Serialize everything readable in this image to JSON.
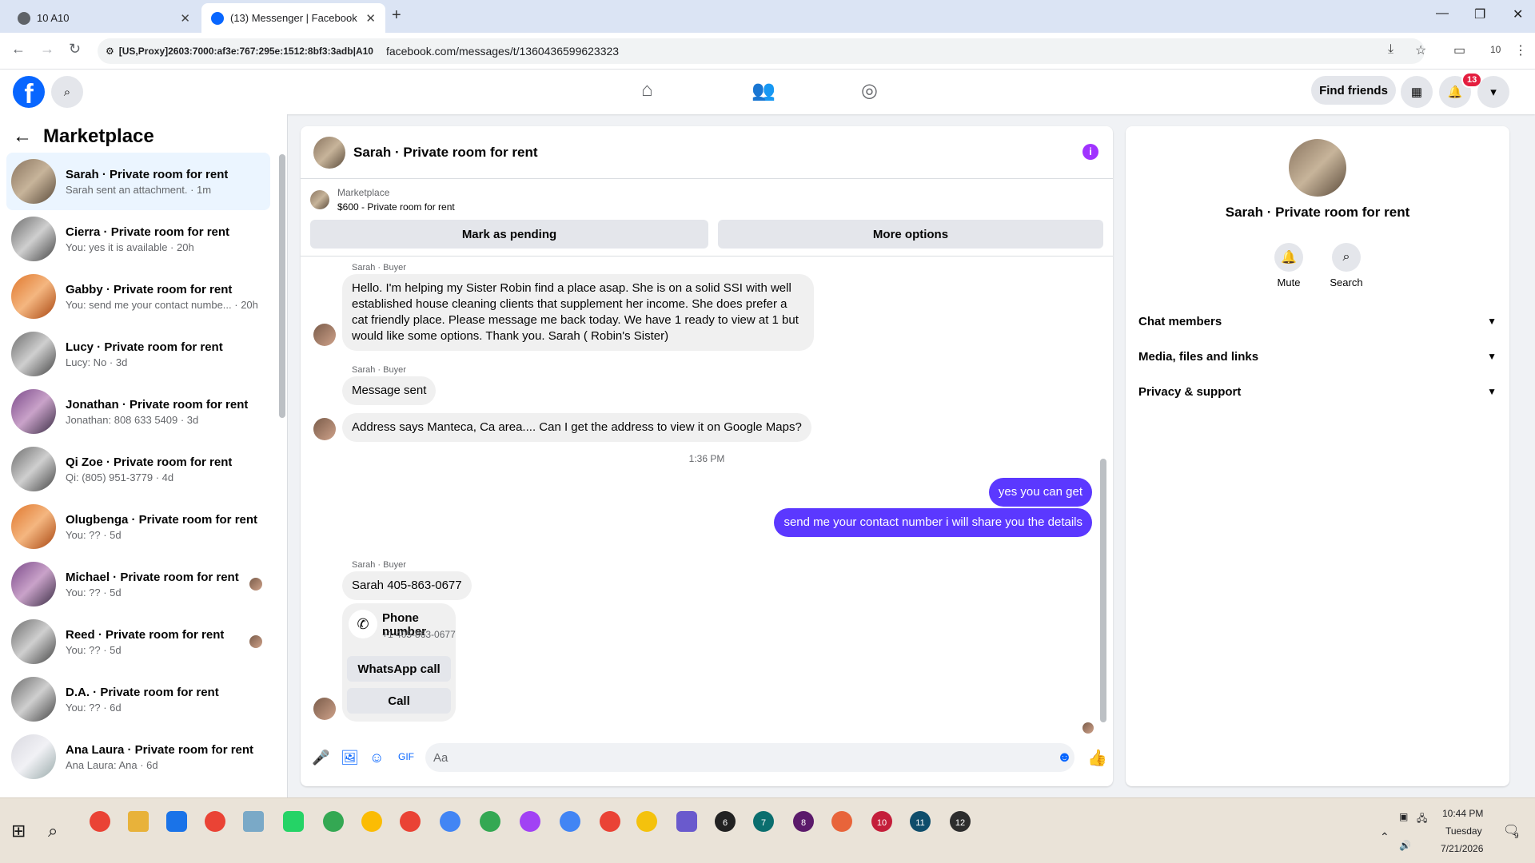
{
  "browser": {
    "tabs": [
      {
        "label": "10 A10"
      },
      {
        "label": "(13) Messenger | Facebook"
      }
    ],
    "proxy": "[US,Proxy]2603:7000:af3e:767:295e:1512:8bf3:3adb|A10",
    "url": "facebook.com/messages/t/1360436599623323",
    "profile_badge": "10"
  },
  "fb": {
    "logo_letter": "f",
    "find_friends": "Find friends",
    "notif_count": "13"
  },
  "sidebar": {
    "title": "Marketplace",
    "conversations": [
      {
        "name": "Sarah · Private room for rent",
        "preview": "Sarah sent an attachment. · 1m"
      },
      {
        "name": "Cierra · Private room for rent",
        "preview": "You: yes it is available · 20h"
      },
      {
        "name": "Gabby · Private room for rent",
        "preview": "You: send me your contact numbe... · 20h"
      },
      {
        "name": "Lucy · Private room for rent",
        "preview": "Lucy: No · 3d"
      },
      {
        "name": "Jonathan · Private room for rent",
        "preview": "Jonathan: 808 633 5409 · 3d"
      },
      {
        "name": "Qi Zoe · Private room for rent",
        "preview": "Qi:  (805)  951-3779 · 4d"
      },
      {
        "name": "Olugbenga · Private room for rent",
        "preview": "You: ?? · 5d"
      },
      {
        "name": "Michael · Private room for rent",
        "preview": "You: ?? · 5d"
      },
      {
        "name": "Reed · Private room for rent",
        "preview": "You: ?? · 5d"
      },
      {
        "name": "D.A. · Private room for rent",
        "preview": "You: ?? · 6d"
      },
      {
        "name": "Ana Laura · Private room for rent",
        "preview": "Ana Laura: Ana · 6d"
      }
    ]
  },
  "chat": {
    "title": "Sarah · Private room for rent",
    "marketplace_label": "Marketplace",
    "listing": "$600 - Private room for rent",
    "mark_pending": "Mark as pending",
    "more_options": "More options",
    "sender_label": "Sarah · Buyer",
    "msg1": "Hello. I'm helping my Sister Robin find a place asap. She is on a solid SSI with well established house cleaning clients that supplement her income. She does prefer a cat friendly place.  Please message me back today. We have 1 ready to view at 1 but would like some options. Thank you. Sarah ( Robin's Sister)",
    "msg2": "Message sent",
    "msg3": "Address says Manteca, Ca area.... Can I get the address to view it on Google Maps?",
    "timestamp": "1:36 PM",
    "out1": "yes you can get",
    "out2": "send me your contact number i will share you the details",
    "msg4": "Sarah 405-863-0677",
    "phone_title": "Phone number",
    "phone_number": "+1 405-863-0677",
    "whatsapp_call": "WhatsApp call",
    "call": "Call",
    "composer_placeholder": "Aa"
  },
  "info_panel": {
    "name": "Sarah · Private room for rent",
    "mute": "Mute",
    "search": "Search",
    "sections": [
      "Chat members",
      "Media, files and links",
      "Privacy & support"
    ]
  },
  "taskbar": {
    "time": "10:44 PM",
    "day": "Tuesday",
    "date": "7/21/2026",
    "notif": "9",
    "app_numbers": [
      "6",
      "7",
      "8",
      "10",
      "11",
      "12"
    ]
  }
}
